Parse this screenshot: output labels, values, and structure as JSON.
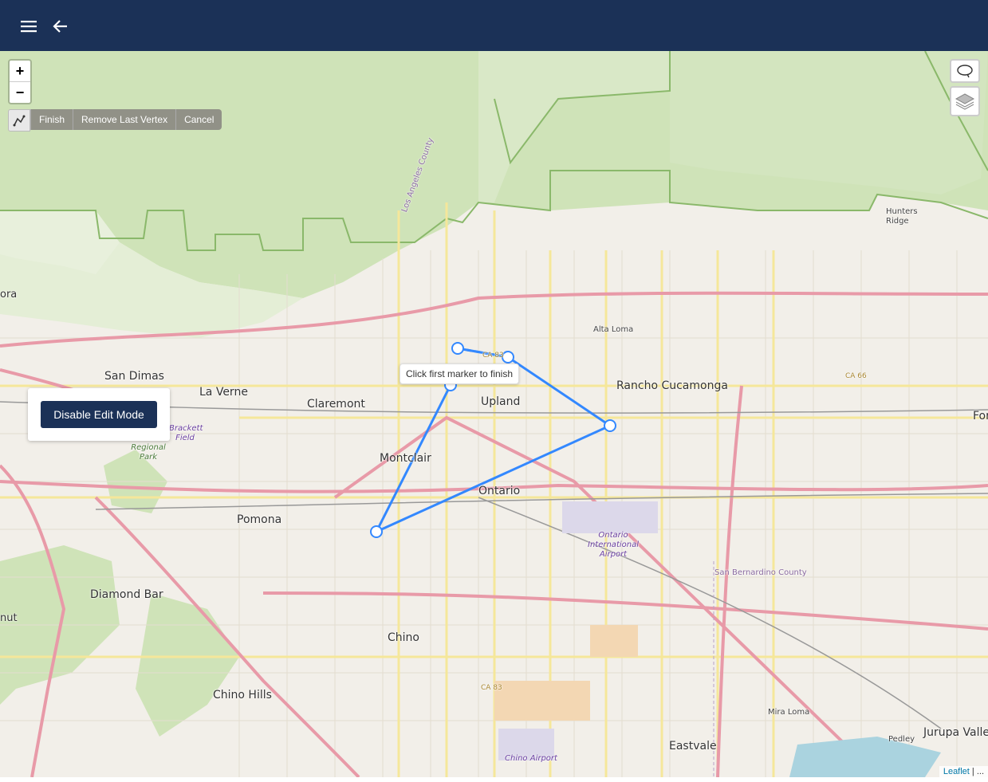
{
  "header": {
    "menu_icon": "hamburger-menu-icon",
    "back_icon": "arrow-left-icon"
  },
  "map": {
    "zoom_in": "+",
    "zoom_out": "−",
    "draw_toolbar": {
      "tool_icon": "draw-polyline-icon",
      "finish": "Finish",
      "remove_last_vertex": "Remove Last Vertex",
      "cancel": "Cancel"
    },
    "tooltip": "Click first marker to finish",
    "edit_button": "Disable Edit Mode",
    "controls": {
      "lasso_icon": "lasso-icon",
      "layers_icon": "layers-icon"
    },
    "attribution": {
      "link": "Leaflet",
      "rest": " | ..."
    },
    "places": {
      "ora": "ora",
      "san_dimas": "San Dimas",
      "la_verne": "La Verne",
      "claremont": "Claremont",
      "upland": "Upland",
      "alta_loma": "Alta Loma",
      "rancho_cucamonga": "Rancho Cucamonga",
      "montclair": "Montclair",
      "ontario": "Ontario",
      "pomona": "Pomona",
      "diamond_bar": "Diamond Bar",
      "chino": "Chino",
      "chino_hills": "Chino Hills",
      "eastvale": "Eastvale",
      "mira_loma": "Mira Loma",
      "jurupa_valley": "Jurupa Valley",
      "pedley": "Pedley",
      "hunters_ridge": "Hunters Ridge",
      "for": "For",
      "nut": "nut",
      "regional_park": "Regional Park",
      "brackett_field": "Brackett Field",
      "ontario_airport": "Ontario International Airport",
      "chino_airport": "Chino Airport",
      "sb_county": "San Bernardino County",
      "la_county": "Los Angeles County",
      "ca83_top": "CA 83",
      "ca83_bottom": "CA 83",
      "ca66": "CA 66"
    },
    "polygon_vertex_count": 5
  }
}
